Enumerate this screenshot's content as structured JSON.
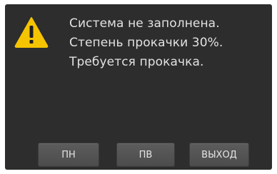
{
  "dialog": {
    "icon": "warning-icon",
    "icon_color": "#f5c400",
    "message_lines": [
      "Система не заполнена.",
      "Степень прокачки 30%.",
      "Требуется прокачка."
    ]
  },
  "buttons": {
    "pn_label": "ПН",
    "pv_label": "ПВ",
    "exit_label": "ВЫХОД"
  }
}
